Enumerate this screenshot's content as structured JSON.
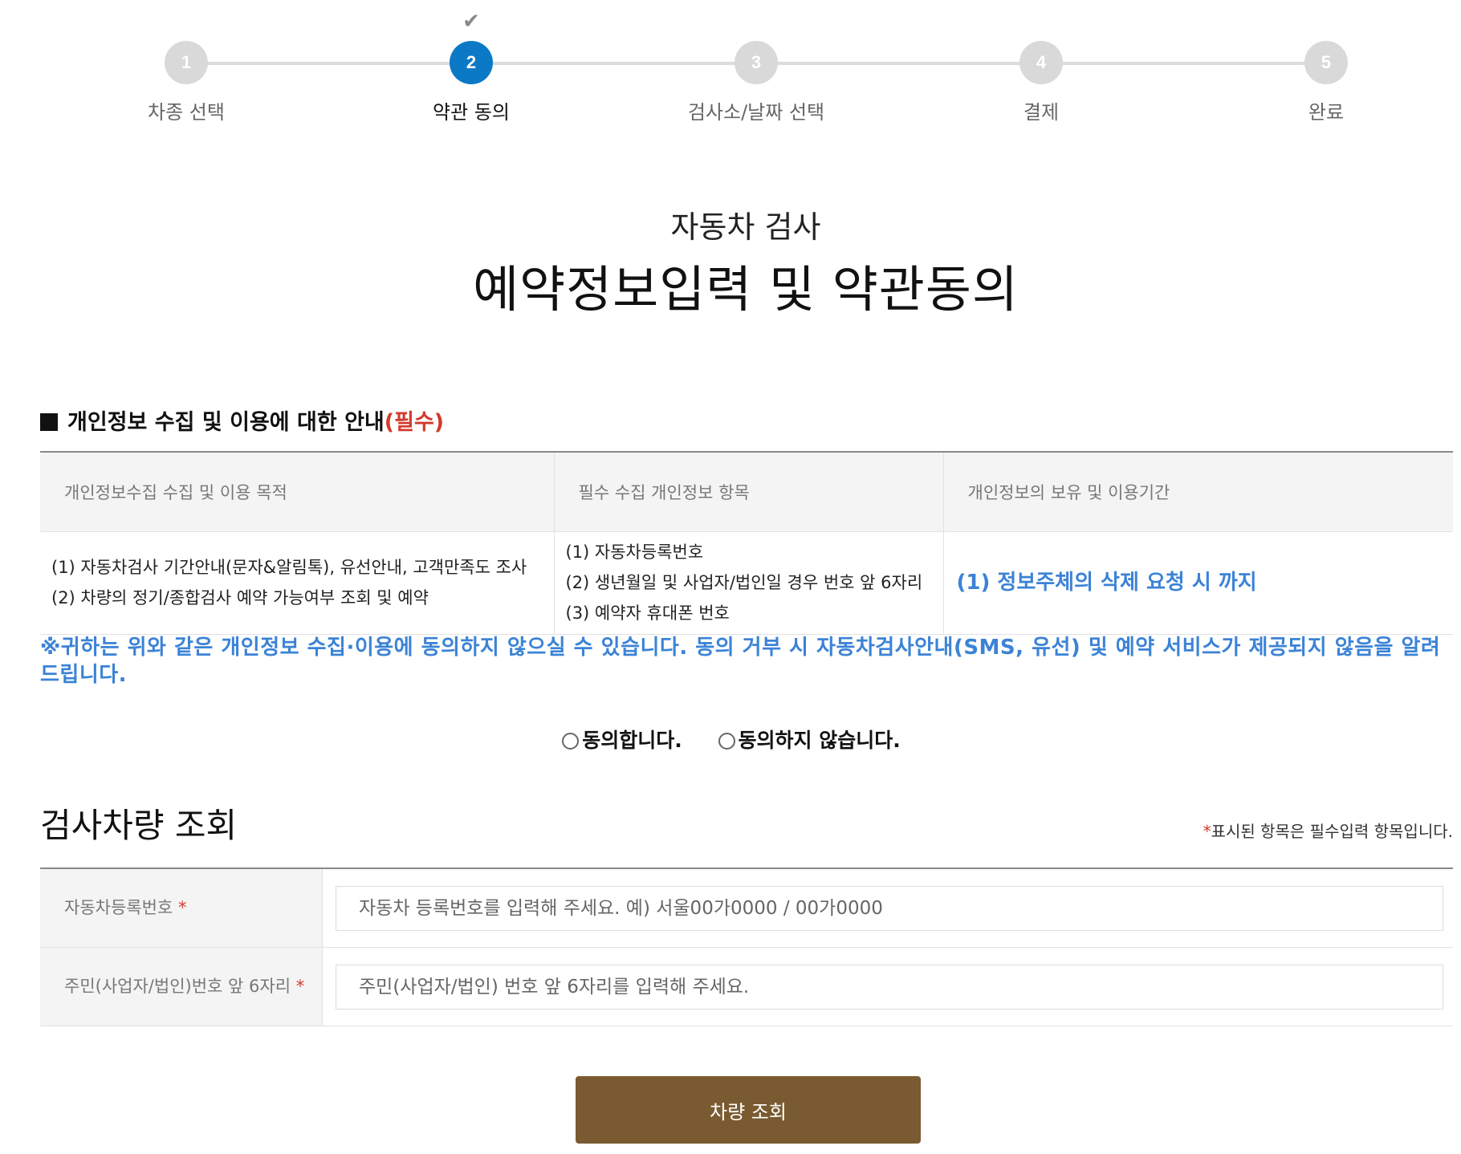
{
  "stepper": {
    "steps": [
      {
        "number": "1",
        "label": "차종 선택"
      },
      {
        "number": "2",
        "label": "약관 동의"
      },
      {
        "number": "3",
        "label": "검사소/날짜 선택"
      },
      {
        "number": "4",
        "label": "결제"
      },
      {
        "number": "5",
        "label": "완료"
      }
    ],
    "active_index": 1,
    "active_color": "#0c79c6",
    "inactive_color": "#d9d9d9",
    "check_icon": "✔"
  },
  "header": {
    "subtitle": "자동차 검사",
    "title": "예약정보입력 및 약관동의"
  },
  "privacy": {
    "heading": "개인정보 수집 및 이용에 대한 안내",
    "heading_required": "(필수)",
    "columns": [
      "개인정보수집 수집 및 이용 목적",
      "필수 수집 개인정보 항목",
      "개인정보의 보유 및 이용기간"
    ],
    "purpose": [
      "(1) 자동차검사 기간안내(문자&알림톡), 유선안내, 고객만족도 조사",
      "(2) 차량의 정기/종합검사 예약 가능여부 조회 및 예약"
    ],
    "items": [
      "(1) 자동차등록번호",
      "(2) 생년월일 및 사업자/법인일 경우 번호 앞 6자리",
      "(3) 예약자 휴대폰 번호"
    ],
    "retention": "(1) 정보주체의 삭제 요청 시 까지",
    "notice": "※귀하는 위와 같은 개인정보 수집·이용에 동의하지 않으실 수 있습니다. 동의 거부 시 자동차검사안내(SMS, 유선) 및 예약 서비스가 제공되지 않음을 알려드립니다.",
    "agree_label": "동의합니다.",
    "disagree_label": "동의하지 않습니다.",
    "accent_color": "#3b83d6"
  },
  "lookup": {
    "title": "검사차량 조회",
    "required_note_star": "*",
    "required_note": "표시된 항목은 필수입력 항목입니다.",
    "fields": [
      {
        "label": "자동차등록번호",
        "star": "*",
        "placeholder": "자동차 등록번호를 입력해 주세요. 예) 서울00가0000 / 00가0000"
      },
      {
        "label": "주민(사업자/법인)번호 앞 6자리",
        "star": "*",
        "placeholder": "주민(사업자/법인) 번호 앞 6자리를 입력해 주세요."
      }
    ],
    "button_label": "차량 조회",
    "button_color": "#7a5a30"
  }
}
